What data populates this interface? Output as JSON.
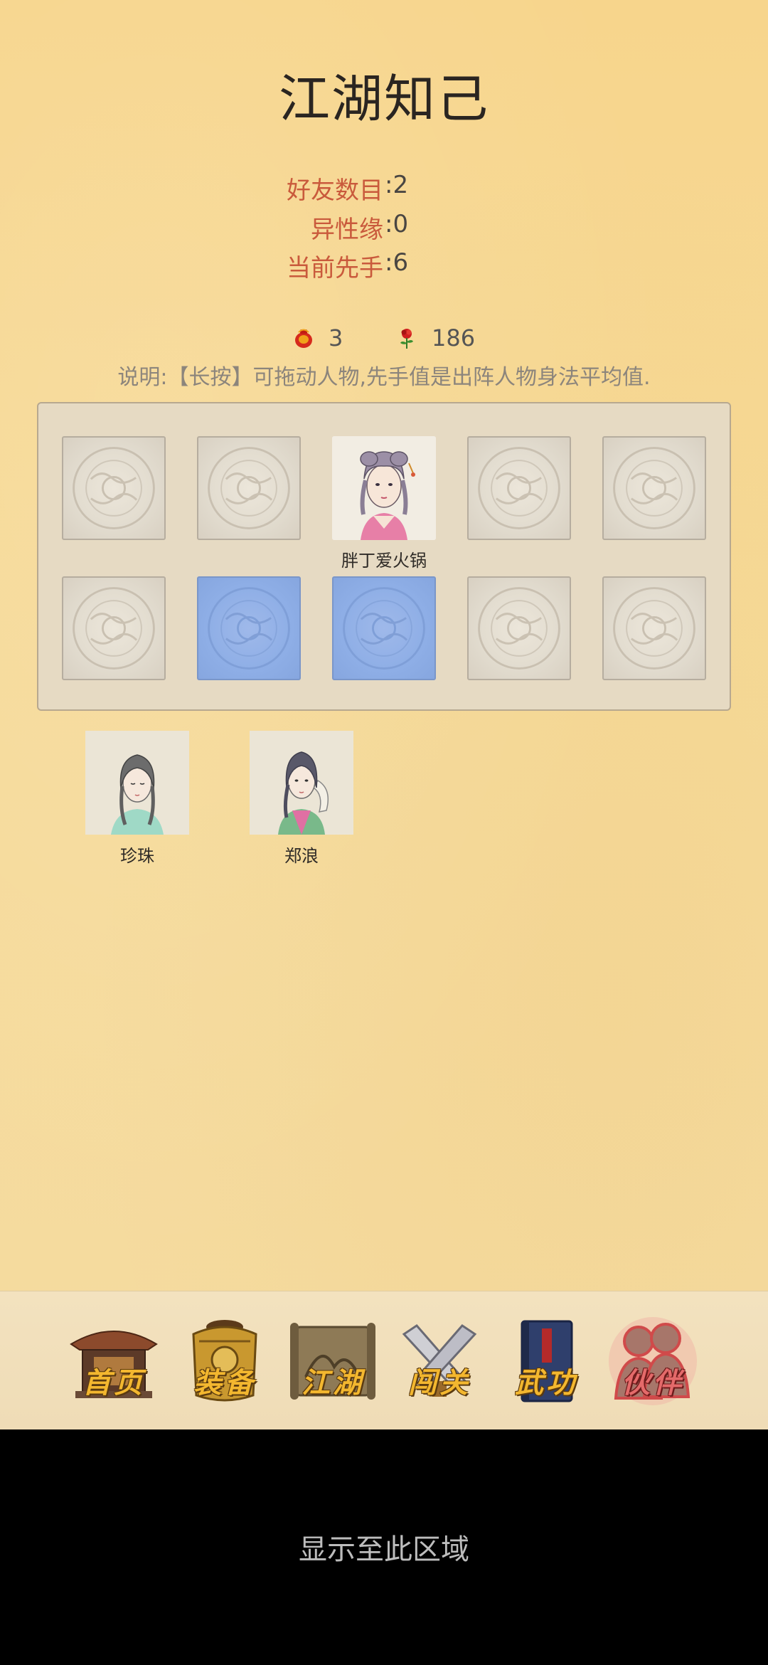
{
  "title": "江湖知己",
  "stats": [
    {
      "label": "好友数目",
      "value": ":2"
    },
    {
      "label": "异性缘",
      "value": ":0"
    },
    {
      "label": "当前先手",
      "value": ":6"
    }
  ],
  "resources": {
    "token_icon": "red-pouch-icon",
    "token_count": "3",
    "rose_icon": "rose-icon",
    "rose_count": "186"
  },
  "note": "说明:【长按】可拖动人物,先手值是出阵人物身法平均值.",
  "formation": {
    "slots_row1": [
      "empty",
      "empty",
      "occupied",
      "empty",
      "empty"
    ],
    "slots_row2": [
      "empty",
      "highlight",
      "highlight",
      "empty",
      "empty"
    ],
    "occupied_name": "胖丁爱火锅"
  },
  "reserve": [
    {
      "name": "珍珠"
    },
    {
      "name": "郑浪"
    }
  ],
  "nav": [
    {
      "label": "首页",
      "icon": "temple-icon",
      "active": false
    },
    {
      "label": "装备",
      "icon": "armor-icon",
      "active": false
    },
    {
      "label": "江湖",
      "icon": "scroll-icon",
      "active": false
    },
    {
      "label": "闯关",
      "icon": "crossed-swords-icon",
      "active": false
    },
    {
      "label": "武功",
      "icon": "book-icon",
      "active": false
    },
    {
      "label": "伙伴",
      "icon": "partners-icon",
      "active": true
    }
  ],
  "colors": {
    "accent_label": "#c95a3c",
    "highlight_slot": "#8eaee6",
    "nav_gold": "#f3b72f",
    "nav_active": "#e46a6a"
  },
  "footer_text": "显示至此区域"
}
